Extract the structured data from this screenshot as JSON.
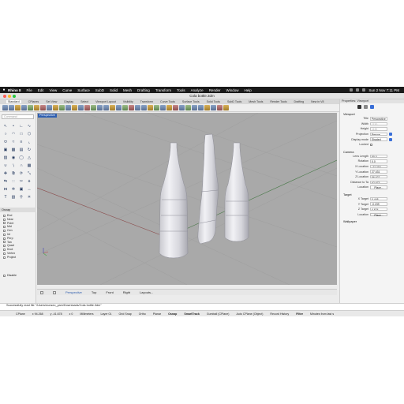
{
  "menubar": {
    "apple": "",
    "items": [
      "Rhino 8",
      "File",
      "Edit",
      "View",
      "Curve",
      "Surface",
      "SubD",
      "Solid",
      "Mesh",
      "Drafting",
      "Transform",
      "Tools",
      "Analyze",
      "Render",
      "Window",
      "Help"
    ],
    "clock": "Sun 2 Nov  7:11 PM"
  },
  "window": {
    "title": "Cola bottle.3dm"
  },
  "tabs": [
    "Standard",
    "CPlanes",
    "Set View",
    "Display",
    "Select",
    "Viewport Layout",
    "Visibility",
    "Transform",
    "Curve Tools",
    "Surface Tools",
    "Solid Tools",
    "SubD Tools",
    "Mesh Tools",
    "Render Tools",
    "Drafting",
    "New in V8"
  ],
  "command": {
    "placeholder": "Command"
  },
  "viewport": {
    "title": "Perspective"
  },
  "osnap": {
    "header": "Osnap",
    "items": [
      "End",
      "Near",
      "Point",
      "Mid",
      "Cen",
      "Int",
      "Perp",
      "Tan",
      "Quad",
      "Knot",
      "Vertex",
      "Project"
    ],
    "disable": "Disable"
  },
  "view_tabs": [
    "Perspective",
    "Top",
    "Front",
    "Right",
    "Layouts..."
  ],
  "properties": {
    "header": "Properties: Viewport",
    "viewport_section": "Viewport",
    "viewport_rows": [
      {
        "label": "Title",
        "value": "Perspective"
      },
      {
        "label": "Width",
        "value": "1130"
      },
      {
        "label": "Height",
        "value": "1130"
      },
      {
        "label": "Projection",
        "value": "Perspe..."
      },
      {
        "label": "Display mode",
        "value": "Shaded"
      },
      {
        "label": "Locked",
        "value": ""
      }
    ],
    "camera_section": "Camera",
    "camera_rows": [
      {
        "label": "Lens Length",
        "value": "50.0"
      },
      {
        "label": "Rotation",
        "value": "0.0"
      },
      {
        "label": "X Location",
        "value": "-27.218"
      },
      {
        "label": "Y Location",
        "value": "27.431"
      },
      {
        "label": "Z Location",
        "value": "56.627"
      },
      {
        "label": "Distance to Ta",
        "value": "62.673"
      },
      {
        "label": "Location",
        "value": "Place..."
      }
    ],
    "target_section": "Target",
    "target_rows": [
      {
        "label": "X Target",
        "value": "0.448"
      },
      {
        "label": "Y Target",
        "value": "-0.239"
      },
      {
        "label": "Z Target",
        "value": "4.624"
      },
      {
        "label": "Location",
        "value": "Place..."
      }
    ],
    "wallpaper_section": "Wallpaper"
  },
  "command_history": "Successfully read file \"/Users/eunseo_yam/Downloads/Cola bottle.3dm\"",
  "status": {
    "cplane": "CPlane",
    "x": "x 94.268",
    "y": "y -41.678",
    "z": "z 0",
    "units": "Millimeters",
    "layer": "Layer 01",
    "items": [
      "Grid Snap",
      "Ortho",
      "Planar",
      "Osnap",
      "SmartTrack",
      "Gumball (CPlane)",
      "Auto CPlane (Object)",
      "Record History",
      "Filter",
      "Minutes from last s"
    ]
  },
  "colors": {
    "accent": "#2f5fb0",
    "viewport_bg": "#a9a9a9",
    "menubar_bg": "#1a1a1a"
  }
}
